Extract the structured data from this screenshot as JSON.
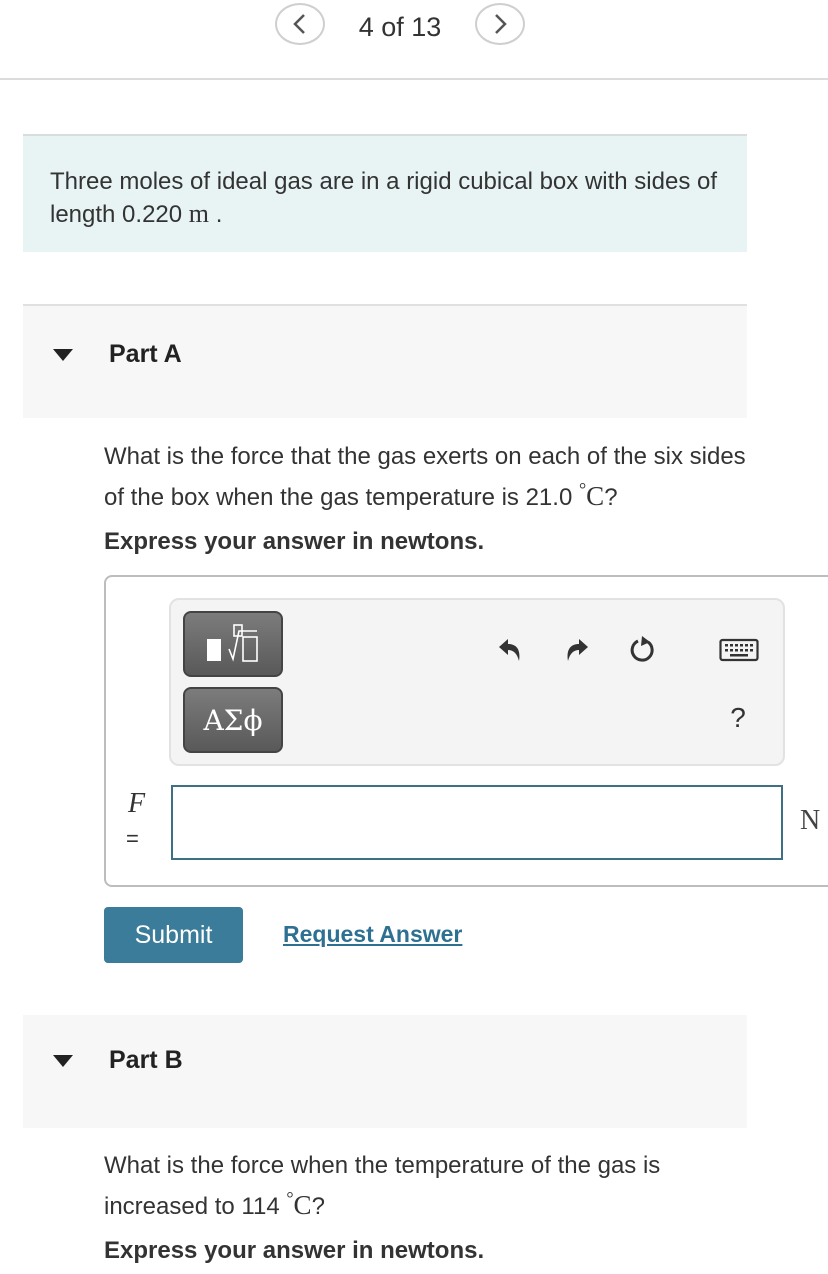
{
  "pager": {
    "prev_icon": "chevron-left-icon",
    "next_icon": "chevron-right-icon",
    "position_text": "4 of 13"
  },
  "intro": {
    "text_before": "Three moles of ideal gas are in a rigid cubical box with sides of length 0.220 ",
    "unit": "m",
    "text_after": " ."
  },
  "part_a": {
    "label": "Part A",
    "question_before": "What is the force that the gas exerts on each of the six sides of the box when the gas temperature is 21.0 ",
    "degree": "°",
    "temp_unit": "C",
    "question_after": "?",
    "instruction": "Express your answer in newtons.",
    "toolbar": {
      "template_button_icon": "templates-root-icon",
      "greek_button_label": "ΑΣϕ",
      "undo_icon": "undo-icon",
      "redo_icon": "redo-icon",
      "reset_icon": "reset-icon",
      "keyboard_icon": "keyboard-icon",
      "help_label": "?"
    },
    "variable": "F",
    "equals": "=",
    "answer_value": "",
    "answer_placeholder": "",
    "unit": "N",
    "submit_label": "Submit",
    "request_label": "Request Answer"
  },
  "part_b": {
    "label": "Part B",
    "question_before": "What is the force when the temperature of the gas is increased to 114 ",
    "degree": "°",
    "temp_unit": "C",
    "question_after": "?",
    "instruction": "Express your answer in newtons."
  }
}
